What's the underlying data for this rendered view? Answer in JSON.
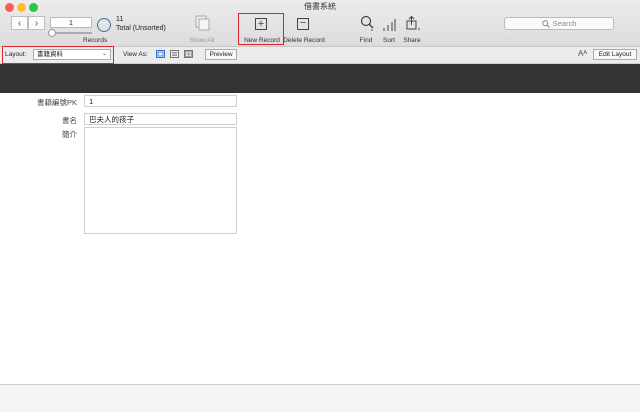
{
  "window": {
    "title": "借書系統"
  },
  "colors": {
    "close": "#fc5f57",
    "minimize": "#fdbc2e",
    "zoom": "#28c840",
    "highlight": "#d9262b",
    "header_band": "#333333"
  },
  "toolbar": {
    "prev_icon": "chevron-left-icon",
    "next_icon": "chevron-right-icon",
    "current_record": "1",
    "records_label": "Records",
    "record_count": "11",
    "found_status": "Total (Unsorted)",
    "show_all_label": "Show All",
    "new_record_label": "New Record",
    "delete_record_label": "Delete Record",
    "find_label": "Find",
    "sort_label": "Sort",
    "share_label": "Share",
    "search_placeholder": "Search"
  },
  "layoutbar": {
    "layout_label": "Layout:",
    "layout_value": "書籍資料",
    "view_as_label": "View As:",
    "preview_label": "Preview",
    "font_icon_glyph": "Aᴬ",
    "edit_layout_label": "Edit Layout"
  },
  "record": {
    "fields": [
      {
        "label": "書籍編號PK",
        "value": "1"
      },
      {
        "label": "書名",
        "value": "巴夫人的孩子"
      },
      {
        "label": "簡介",
        "value": ""
      }
    ]
  }
}
